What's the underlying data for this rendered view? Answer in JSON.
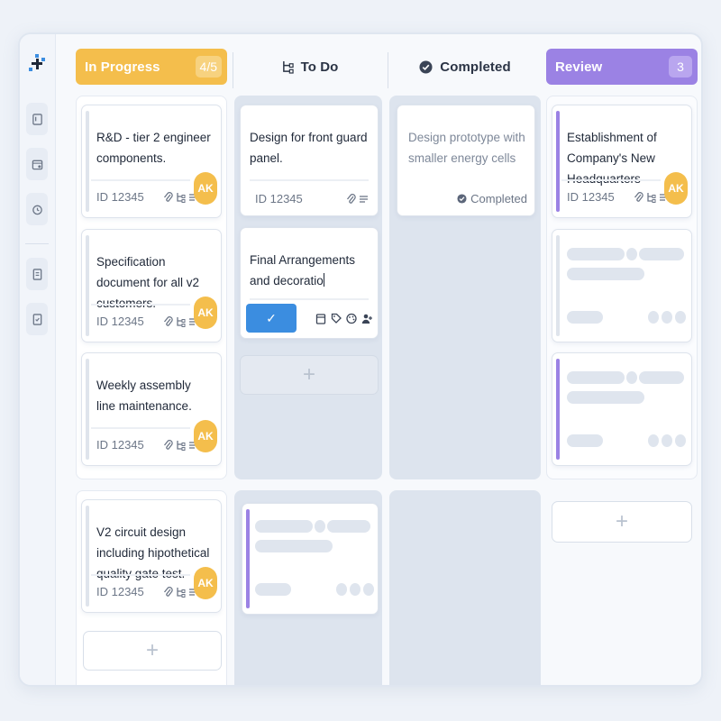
{
  "colors": {
    "in_progress": "#f4be4c",
    "review": "#9b82e4",
    "confirm": "#3b8de0",
    "lane_gray": "#dde4ee"
  },
  "sidebar": {
    "icons": [
      "logo-icon",
      "board-icon",
      "calendar-icon",
      "clock-icon",
      "document-icon",
      "notes-icon"
    ]
  },
  "columns": {
    "in_progress": {
      "title": "In Progress",
      "count": "4/5"
    },
    "todo": {
      "title": "To Do"
    },
    "completed": {
      "title": "Completed"
    },
    "review": {
      "title": "Review",
      "count": "3"
    }
  },
  "cards": {
    "ip1": {
      "title": "R&D - tier 2 engineer components.",
      "id": "ID 12345",
      "avatar": "AK"
    },
    "ip2": {
      "title": "Specification document for all v2 customers.",
      "id": "ID 12345",
      "avatar": "AK"
    },
    "ip3": {
      "title": "Weekly assembly line maintenance.",
      "id": "ID 12345",
      "avatar": "AK"
    },
    "ip4": {
      "title": "V2 circuit design including hipothetical quality gate test.",
      "id": "ID 12345",
      "avatar": "AK"
    },
    "todo1": {
      "title": "Design for front guard panel.",
      "id": "ID 12345"
    },
    "todo2": {
      "title": "Final Arrangements and decoratio",
      "confirm": "✓"
    },
    "done1": {
      "title": "Design prototype with smaller energy cells",
      "status": "Completed"
    },
    "rev1": {
      "title": "Establishment of Company's New Headquarters",
      "id": "ID 12345",
      "avatar": "AK"
    }
  },
  "add_label": "+"
}
